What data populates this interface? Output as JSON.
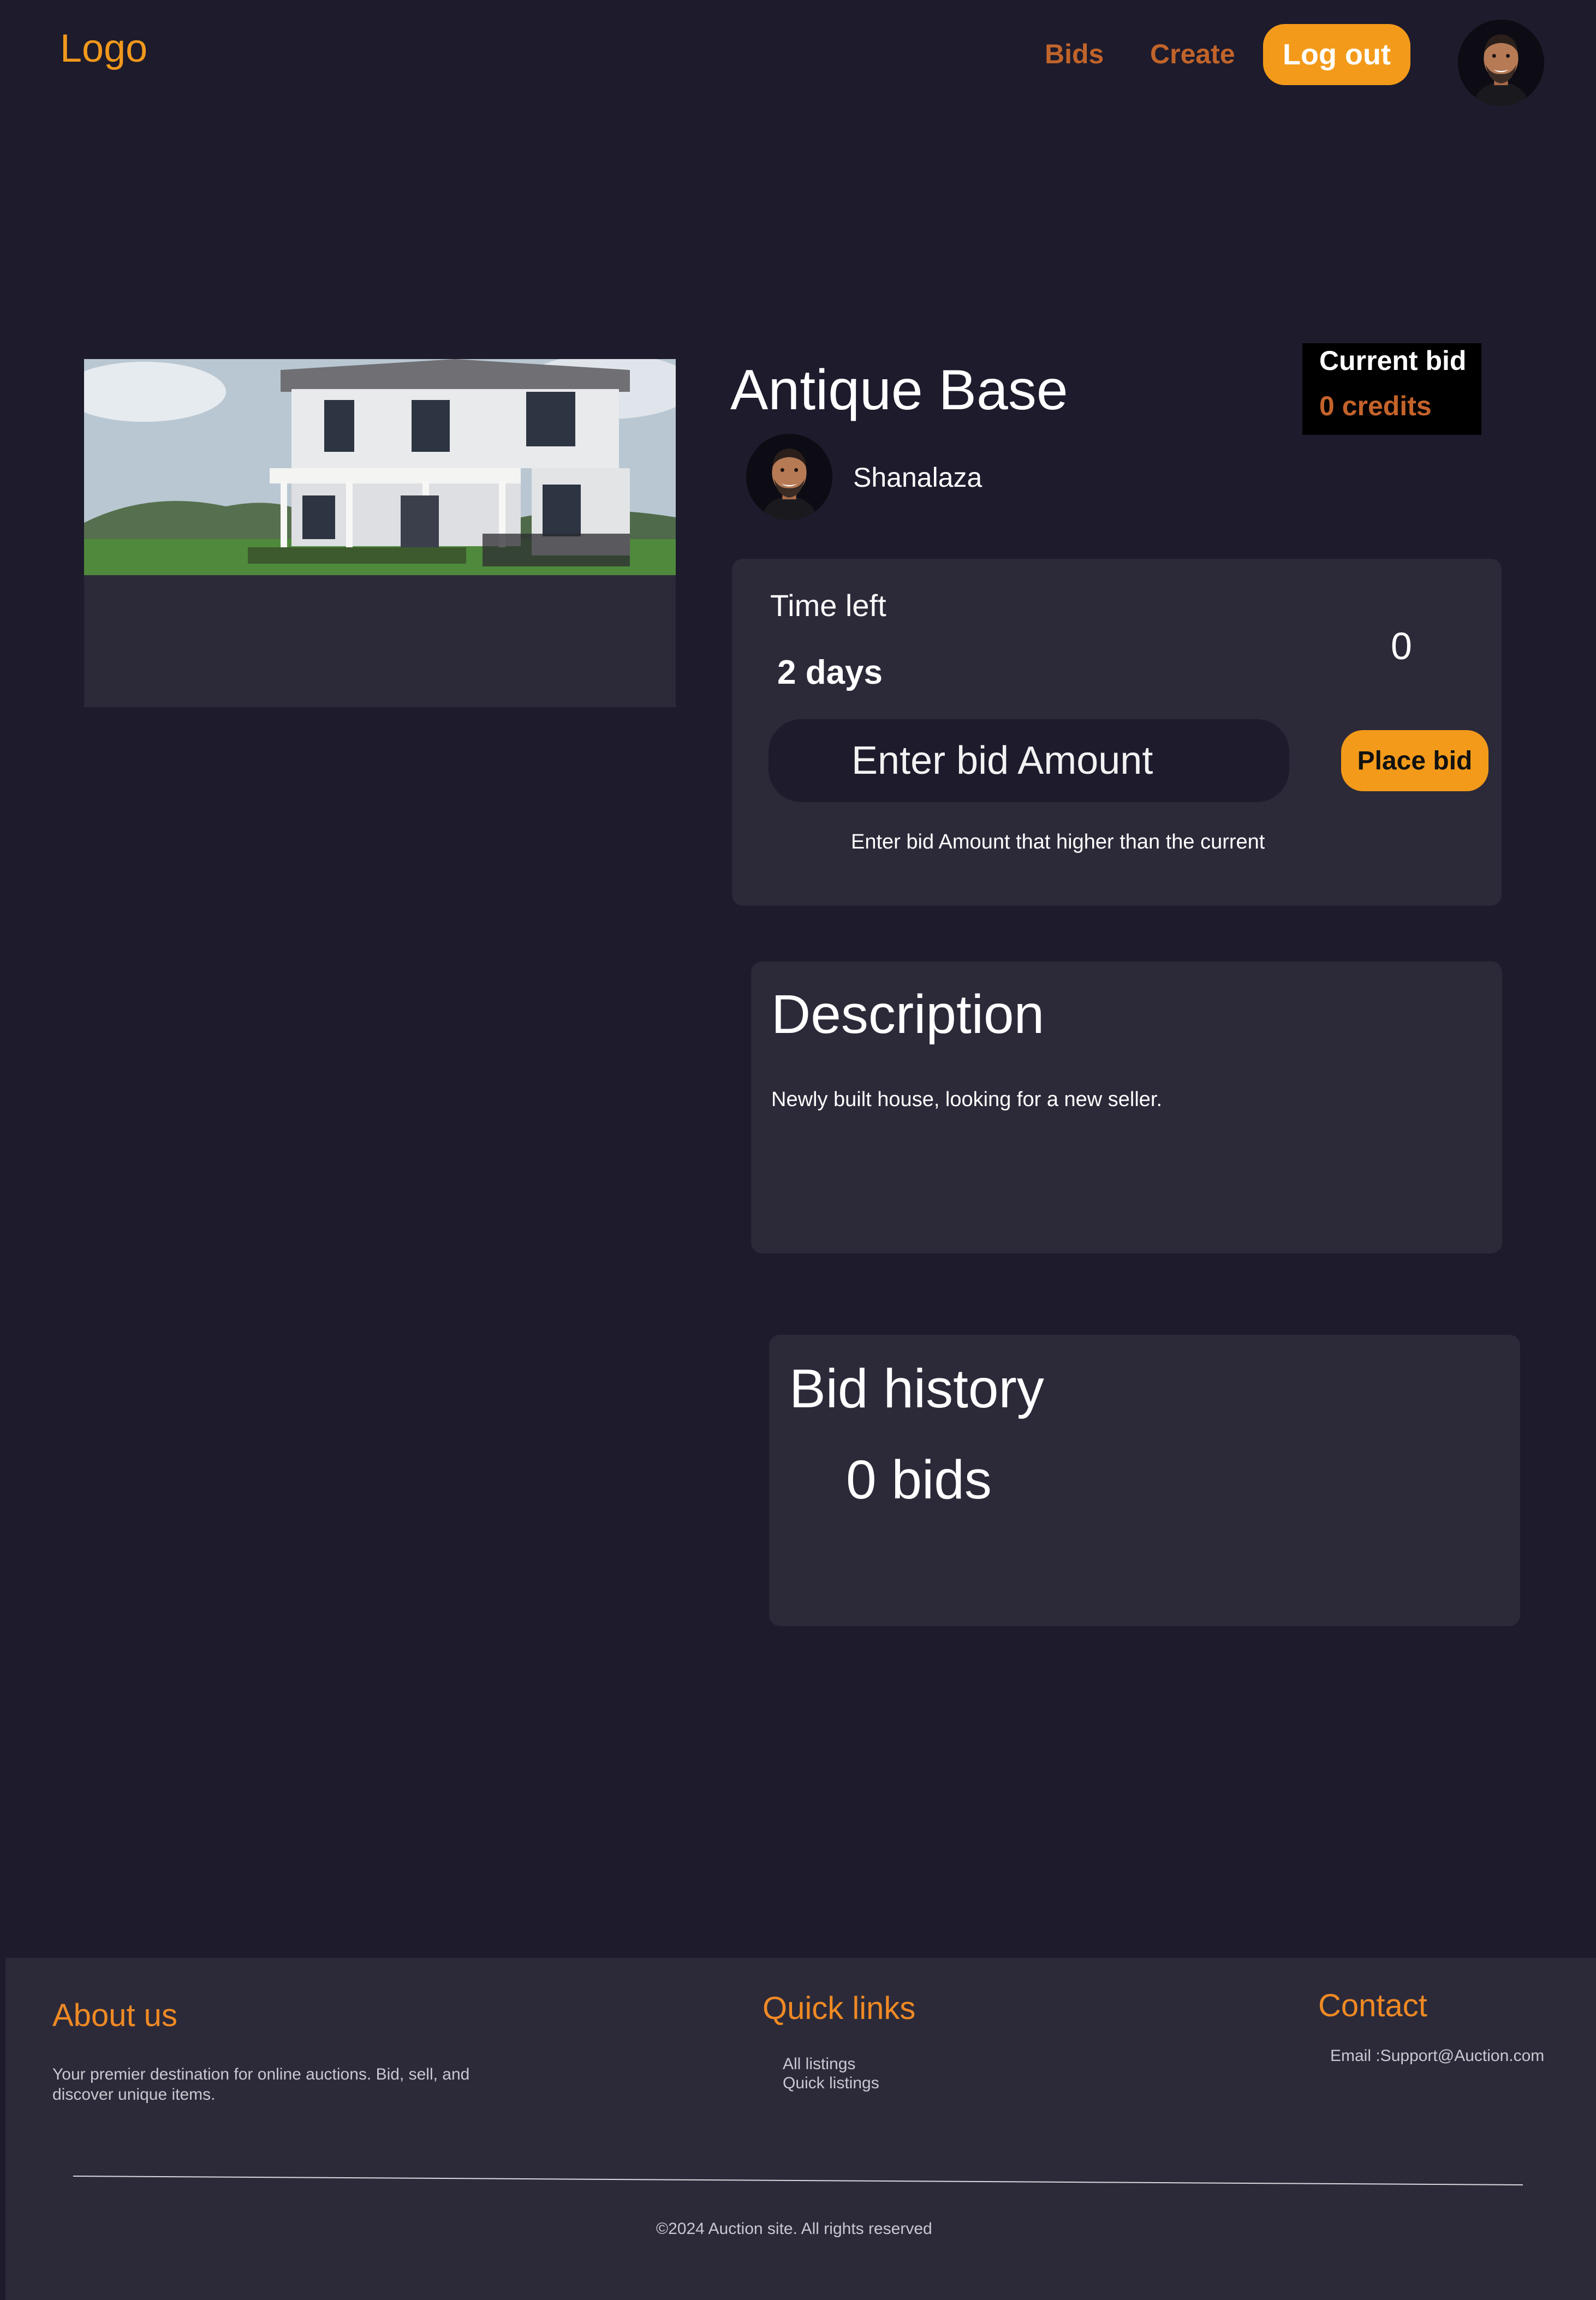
{
  "header": {
    "logo": "Logo",
    "nav": [
      "Bids",
      "Create"
    ],
    "logout_label": "Log out"
  },
  "item": {
    "title": "Antique Base",
    "seller": "Shanalaza",
    "current_bid_label": "Current bid",
    "current_bid_value": "0 credits"
  },
  "bid_panel": {
    "time_left_label": "Time left",
    "time_left_value": "2 days",
    "counter": "0",
    "input_placeholder": "Enter bid Amount",
    "place_bid_label": "Place bid",
    "hint": "Enter bid Amount that higher than the current"
  },
  "description": {
    "title": "Description",
    "text": "Newly built  house, looking for a new seller."
  },
  "bid_history": {
    "title": "Bid history",
    "count": "0 bids"
  },
  "footer": {
    "about_title": "About us",
    "about_text": "Your premier destination for online auctions. Bid, sell, and discover unique items.",
    "quick_links_title": "Quick links",
    "quick_links": [
      "All listings",
      "Quick listings"
    ],
    "contact_title": "Contact",
    "contact_email": "Email :Support@Auction.com",
    "copyright": "©2024 Auction site. All rights reserved"
  },
  "colors": {
    "background": "#1d1b2c",
    "panel": "#2c2a39",
    "accent": "#f39a1a",
    "link": "#c1642a"
  },
  "icons": [
    "user-avatar",
    "seller-avatar",
    "house-photo"
  ]
}
